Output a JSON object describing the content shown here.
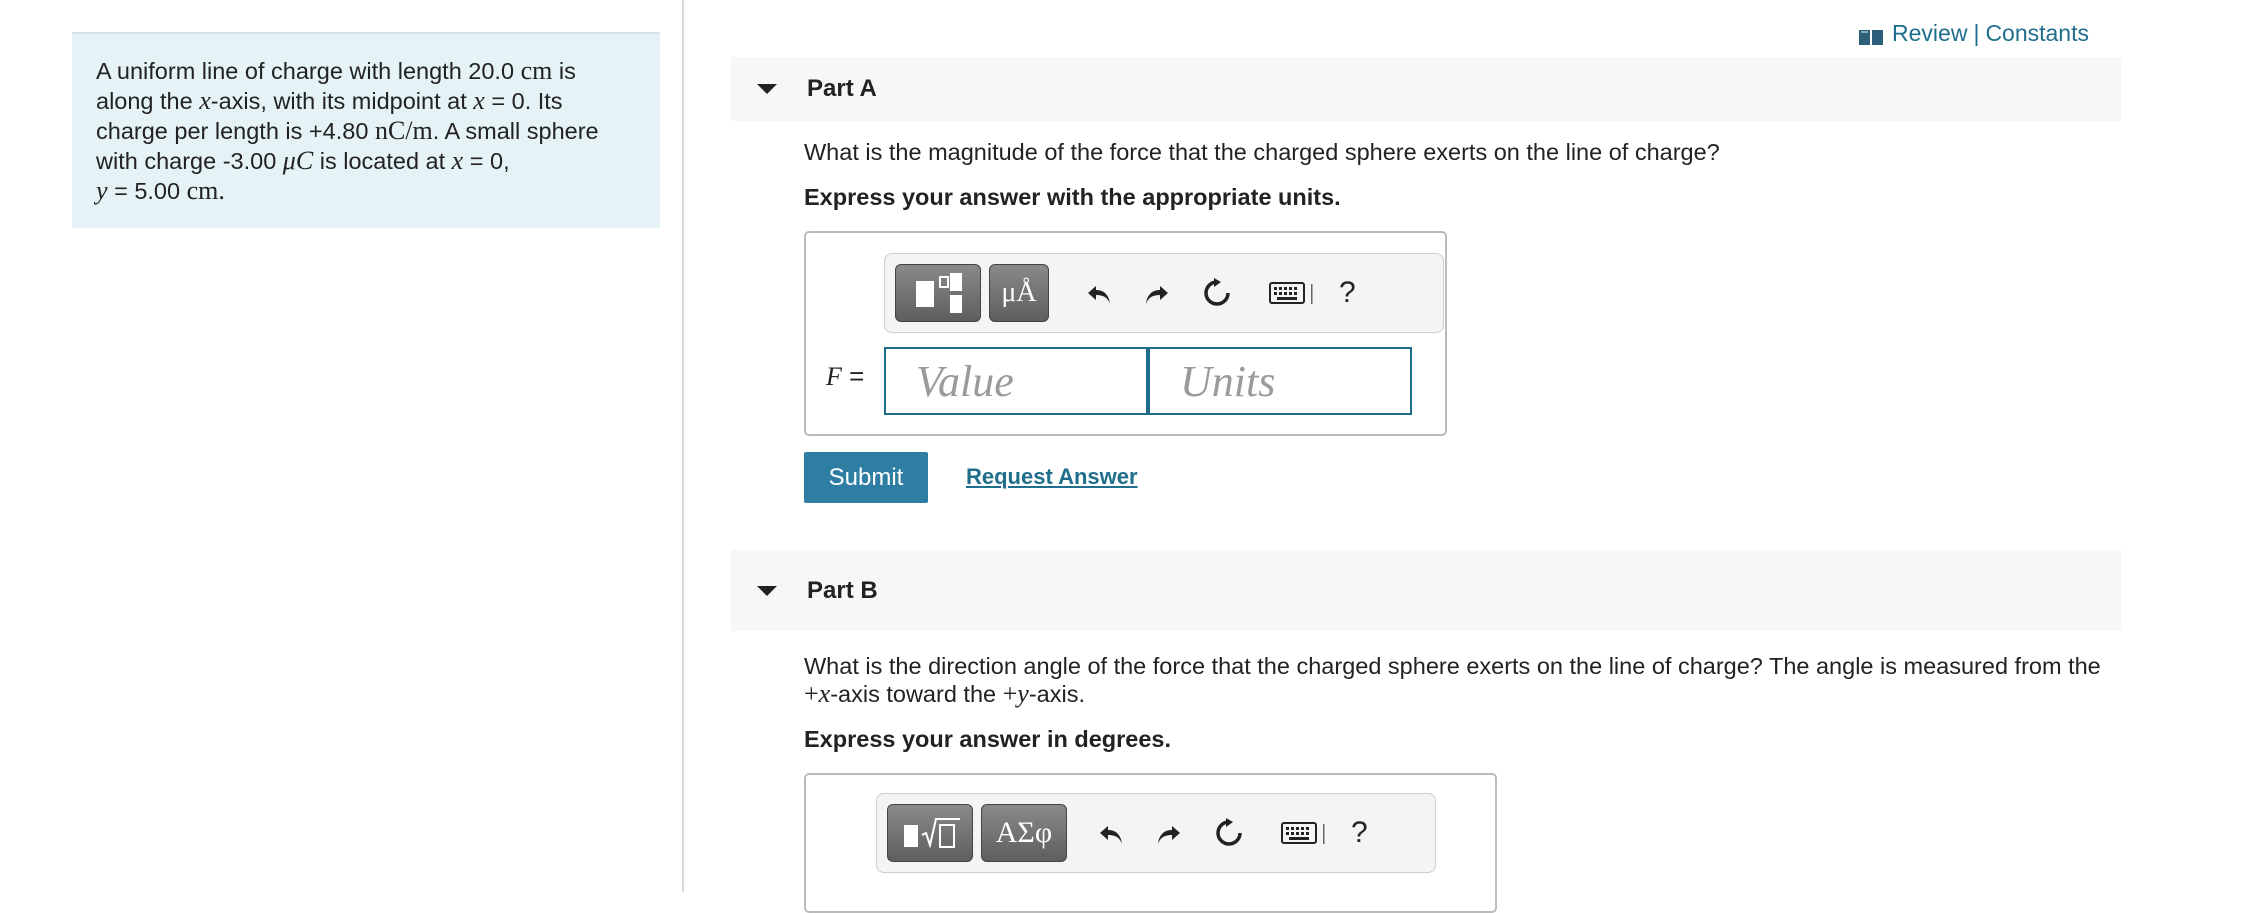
{
  "header": {
    "review_label": "Review",
    "separator": "|",
    "constants_label": "Constants"
  },
  "problem": {
    "p1": "A uniform line of charge with length 20.0",
    "u_cm": "cm",
    "p2": " is along the ",
    "x": "x",
    "p3": "-axis, with its midpoint at ",
    "p4": " = 0. Its charge per length is +4.80 ",
    "u_ncm": "nC/m",
    "p5": ". A small sphere with charge -3.00 ",
    "u_muc": "μC",
    "p6": " is located at ",
    "p7": " = 0,",
    "y": "y",
    "p8": " = 5.00 ",
    "u_cm2": "cm.",
    "p9": ""
  },
  "partA": {
    "title": "Part A",
    "question": "What is the magnitude of the force that the charged sphere exerts on the line of charge?",
    "instruction": "Express your answer with the appropriate units.",
    "units_btn": "μÅ",
    "var_label": "F",
    "equals": " =",
    "value_placeholder": "Value",
    "units_placeholder": "Units",
    "help": "?"
  },
  "actions": {
    "submit": "Submit",
    "request": "Request Answer"
  },
  "partB": {
    "title": "Part B",
    "q1": "What is the direction angle of the force that the charged sphere exerts on the line of charge? The angle is measured from the",
    "q_plus": "+",
    "q_x": "x",
    "q_mid": "-axis toward the ",
    "q_plus2": "+",
    "q_y": "y",
    "q_end": "-axis.",
    "instruction": "Express your answer in degrees.",
    "greek_btn": "ΑΣφ",
    "help": "?"
  },
  "colors": {
    "accent": "#1f6e8c",
    "submit": "#2e7ea3",
    "panel": "#e6f3f6"
  }
}
